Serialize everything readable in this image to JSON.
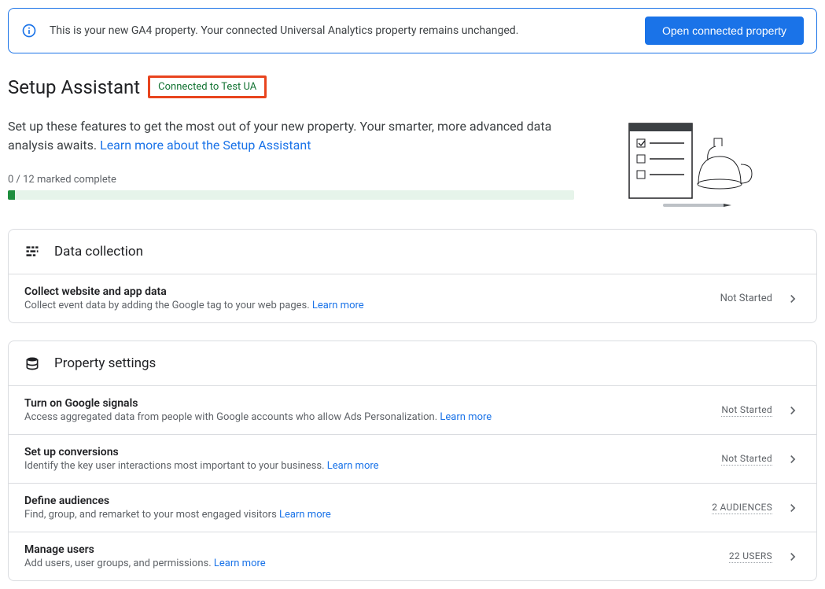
{
  "banner": {
    "text": "This is your new GA4 property. Your connected Universal Analytics property remains unchanged.",
    "button": "Open connected property"
  },
  "title": "Setup Assistant",
  "connection_badge": "Connected to Test UA",
  "description_prefix": "Set up these features to get the most out of your new property. Your smarter, more advanced data analysis awaits. ",
  "description_link": "Learn more about the Setup Assistant",
  "progress": {
    "label": "0 / 12 marked complete"
  },
  "sections": [
    {
      "title": "Data collection",
      "rows": [
        {
          "title": "Collect website and app data",
          "sub": "Collect event data by adding the Google tag to your web pages. ",
          "learn_more": "Learn more",
          "status": "Not Started",
          "status_style": "plain"
        }
      ]
    },
    {
      "title": "Property settings",
      "rows": [
        {
          "title": "Turn on Google signals",
          "sub": "Access aggregated data from people with Google accounts who allow Ads Personalization. ",
          "learn_more": "Learn more",
          "status": "Not Started",
          "status_style": "dotted"
        },
        {
          "title": "Set up conversions",
          "sub": "Identify the key user interactions most important to your business. ",
          "learn_more": "Learn more",
          "status": "Not Started",
          "status_style": "dotted"
        },
        {
          "title": "Define audiences",
          "sub": "Find, group, and remarket to your most engaged visitors ",
          "learn_more": "Learn more",
          "status": "2 AUDIENCES",
          "status_style": "dotted"
        },
        {
          "title": "Manage users",
          "sub": "Add users, user groups, and permissions. ",
          "learn_more": "Learn more",
          "status": "22 USERS",
          "status_style": "dotted"
        }
      ]
    }
  ]
}
